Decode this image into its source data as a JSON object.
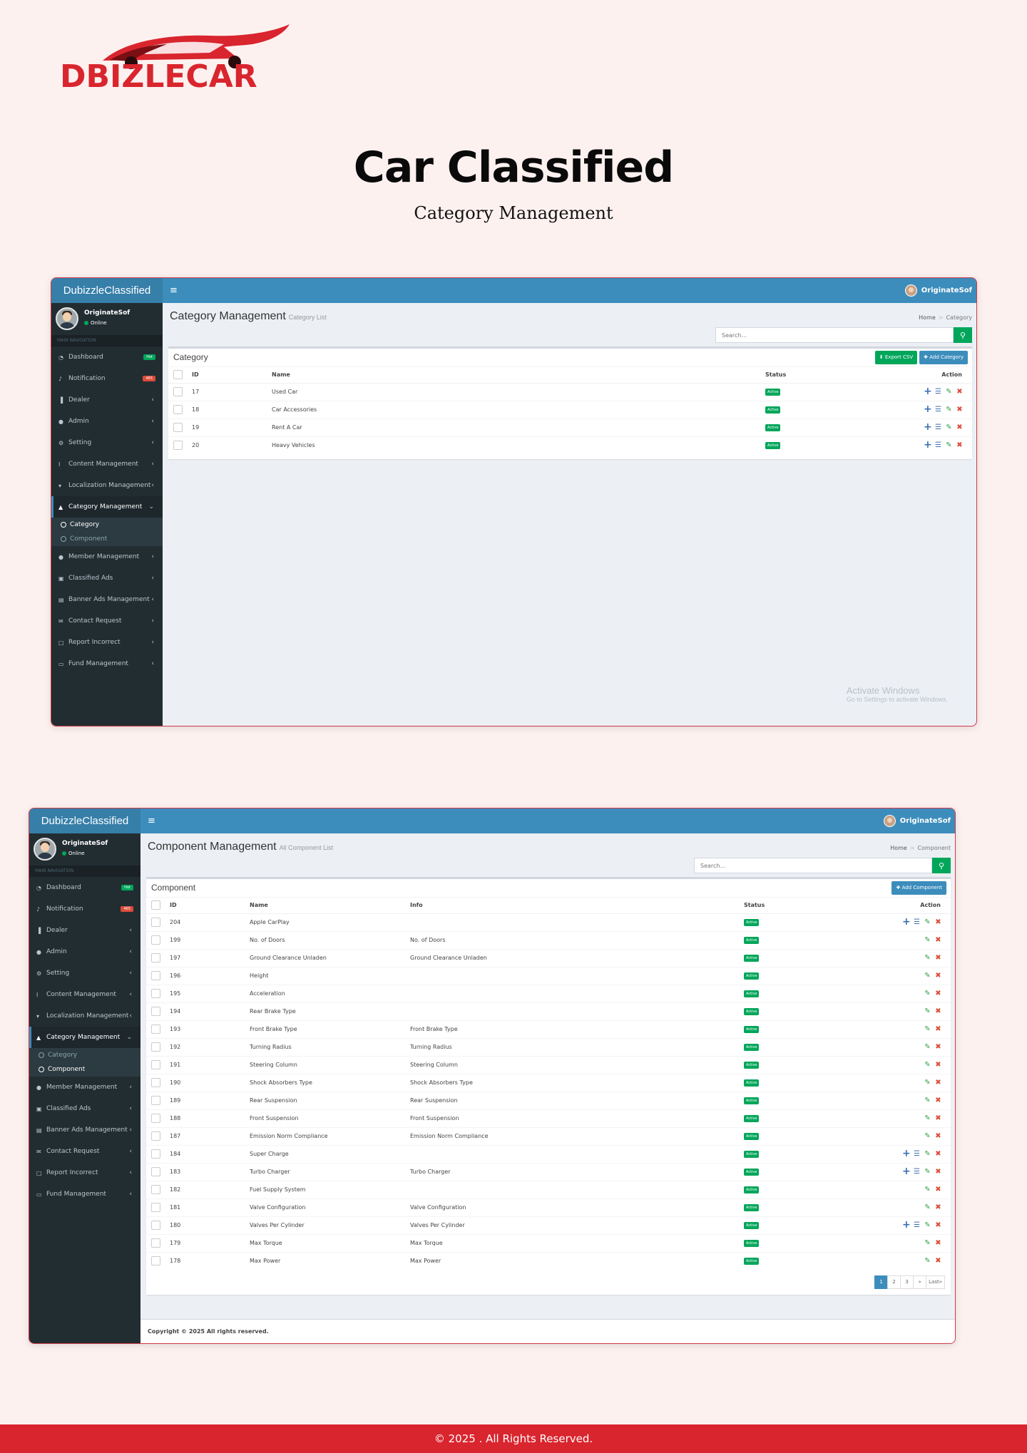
{
  "logo_text": "DBIZLECAR",
  "colors": {
    "accent_red": "#d9252e",
    "topbar_blue": "#3c8dbc",
    "sidebar_dark": "#222d32",
    "status_green": "#00a65a"
  },
  "hero": {
    "title": "Car Classified",
    "subtitle": "Category Management"
  },
  "app": {
    "brand": "DubizzleClassified",
    "user": "OriginateSof",
    "status": "Online",
    "main_nav": "MAIN NAVIGATION",
    "menu_icon": "hamburger-icon",
    "nav": [
      {
        "label": "Dashboard",
        "icon": "dashboard-icon",
        "badge": "Hot"
      },
      {
        "label": "Notification",
        "icon": "bell-icon",
        "badge": "465"
      },
      {
        "label": "Dealer",
        "icon": "bar-chart-icon",
        "chev": "‹"
      },
      {
        "label": "Admin",
        "icon": "user-icon",
        "chev": "‹"
      },
      {
        "label": "Setting",
        "icon": "gear-icon",
        "chev": "‹"
      },
      {
        "label": "Content Management",
        "icon": "text-cursor-icon",
        "chev": "‹"
      },
      {
        "label": "Localization Management",
        "icon": "map-pin-icon",
        "chev": "‹"
      },
      {
        "label": "Category Management",
        "icon": "pointer-icon",
        "chev": "⌄"
      },
      {
        "label": "Member Management",
        "icon": "users-icon",
        "chev": "‹"
      },
      {
        "label": "Classified Ads",
        "icon": "briefcase-icon",
        "chev": "‹"
      },
      {
        "label": "Banner Ads Management",
        "icon": "newspaper-icon",
        "chev": "‹"
      },
      {
        "label": "Contact Request",
        "icon": "envelope-icon",
        "chev": "‹"
      },
      {
        "label": "Report Incorrect",
        "icon": "report-icon",
        "chev": "‹"
      },
      {
        "label": "Fund Management",
        "icon": "money-icon",
        "chev": "‹"
      }
    ],
    "sub_nav": [
      "Category",
      "Component"
    ]
  },
  "screen1": {
    "page_title": "Category Management",
    "page_subtitle": "Category List",
    "breadcrumb": [
      "Home",
      "Category"
    ],
    "search_placeholder": "Search...",
    "box_title": "Category",
    "export_btn": "Export CSV",
    "add_btn": "Add Category",
    "columns": [
      "ID",
      "Name",
      "Status",
      "Action"
    ],
    "rows": [
      {
        "id": "17",
        "name": "Used Car",
        "status": "Active"
      },
      {
        "id": "18",
        "name": "Car Accessories",
        "status": "Active"
      },
      {
        "id": "19",
        "name": "Rent A Car",
        "status": "Active"
      },
      {
        "id": "20",
        "name": "Heavy Vehicles",
        "status": "Active"
      }
    ],
    "watermark": [
      "Activate Windows",
      "Go to Settings to activate Windows."
    ]
  },
  "screen2": {
    "page_title": "Component Management",
    "page_subtitle": "All Component List",
    "breadcrumb": [
      "Home",
      "Component"
    ],
    "search_placeholder": "Search...",
    "box_title": "Component",
    "add_btn": "Add Component",
    "columns": [
      "ID",
      "Name",
      "Info",
      "Status",
      "Action"
    ],
    "rows": [
      {
        "id": "204",
        "name": "Apple CarPlay",
        "info": "",
        "status": "Active",
        "full": true
      },
      {
        "id": "199",
        "name": "No. of Doors",
        "info": "No. of Doors",
        "status": "Active",
        "full": false
      },
      {
        "id": "197",
        "name": "Ground Clearance Unladen",
        "info": "Ground Clearance Unladen",
        "status": "Active",
        "full": false
      },
      {
        "id": "196",
        "name": "Height",
        "info": "",
        "status": "Active",
        "full": false
      },
      {
        "id": "195",
        "name": "Acceleration",
        "info": "",
        "status": "Active",
        "full": false
      },
      {
        "id": "194",
        "name": "Rear Brake Type",
        "info": "",
        "status": "Active",
        "full": false
      },
      {
        "id": "193",
        "name": "Front Brake Type",
        "info": "Front Brake Type",
        "status": "Active",
        "full": false
      },
      {
        "id": "192",
        "name": "Turning Radius",
        "info": "Turning Radius",
        "status": "Active",
        "full": false
      },
      {
        "id": "191",
        "name": "Steering Column",
        "info": "Steering Column",
        "status": "Active",
        "full": false
      },
      {
        "id": "190",
        "name": "Shock Absorbers Type",
        "info": "Shock Absorbers Type",
        "status": "Active",
        "full": false
      },
      {
        "id": "189",
        "name": "Rear Suspension",
        "info": "Rear Suspension",
        "status": "Active",
        "full": false
      },
      {
        "id": "188",
        "name": "Front Suspension",
        "info": "Front Suspension",
        "status": "Active",
        "full": false
      },
      {
        "id": "187",
        "name": "Emission Norm Compliance",
        "info": "Emission Norm Compliance",
        "status": "Active",
        "full": false
      },
      {
        "id": "184",
        "name": "Super Charge",
        "info": "",
        "status": "Active",
        "full": true
      },
      {
        "id": "183",
        "name": "Turbo Charger",
        "info": "Turbo Charger",
        "status": "Active",
        "full": true
      },
      {
        "id": "182",
        "name": "Fuel Supply System",
        "info": "",
        "status": "Active",
        "full": false
      },
      {
        "id": "181",
        "name": "Valve Configuration",
        "info": "Valve Configuration",
        "status": "Active",
        "full": false
      },
      {
        "id": "180",
        "name": "Valves Per Cylinder",
        "info": "Valves Per Cylinder",
        "status": "Active",
        "full": true
      },
      {
        "id": "179",
        "name": "Max Torque",
        "info": "Max Torque",
        "status": "Active",
        "full": false
      },
      {
        "id": "178",
        "name": "Max Power",
        "info": "Max Power",
        "status": "Active",
        "full": false
      }
    ],
    "pagination": [
      "1",
      "2",
      "3",
      "»",
      "Last»"
    ],
    "footer": "Copyright © 2025 All rights reserved."
  },
  "page_footer": "© 2025 . All Rights Reserved."
}
